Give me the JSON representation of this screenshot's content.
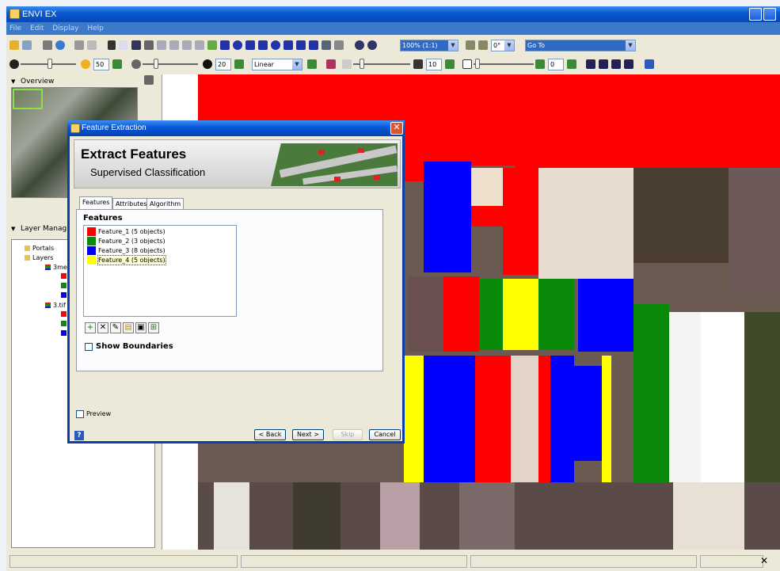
{
  "app": {
    "title": "ENVI EX"
  },
  "menu": [
    "File",
    "Edit",
    "Display",
    "Help"
  ],
  "toolbar1": {
    "zoom_value": "100% (1:1)",
    "rotation_value": "0°",
    "goto_value": "Go To"
  },
  "toolbar2": {
    "brightness_value": "50",
    "contrast_value": "20",
    "stretch_value": "Linear",
    "sharpen_value": "10",
    "transparency_value": "0"
  },
  "panels": {
    "overview_title": "Overview",
    "layer_manager_title": "Layer Manag"
  },
  "layers": {
    "portals": "Portals",
    "layers": "Layers",
    "layer1": "3me",
    "layer2": "3.tif"
  },
  "dialog": {
    "title": "Feature Extraction",
    "banner_title": "Extract Features",
    "banner_subtitle": "Supervised Classification",
    "tabs": [
      "Features",
      "Attributes",
      "Algorithm"
    ],
    "features_header": "Features",
    "features": [
      {
        "label": "Feature_1 (5 objects)",
        "color": "#ff0000"
      },
      {
        "label": "Feature_2 (3 objects)",
        "color": "#0a8a0a"
      },
      {
        "label": "Feature_3 (8 objects)",
        "color": "#0000ff"
      },
      {
        "label": "Feature_4 (5 objects)",
        "color": "#ffff00"
      }
    ],
    "show_boundaries": "Show Boundaries",
    "preview": "Preview",
    "buttons": {
      "back": "< Back",
      "next": "Next >",
      "skip": "Skip",
      "cancel": "Cancel"
    }
  },
  "colors": {
    "titlebar": "#0a5ad0",
    "feature_red": "#ff0000",
    "feature_green": "#0a8a0a",
    "feature_blue": "#0000ff",
    "feature_yellow": "#ffff00"
  }
}
